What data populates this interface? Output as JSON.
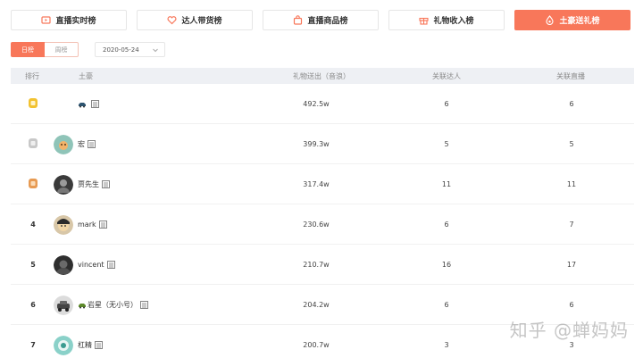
{
  "tabs": [
    {
      "label": "直播实时榜",
      "icon": "live-screen-icon",
      "active": false
    },
    {
      "label": "达人带货榜",
      "icon": "heart-badge-icon",
      "active": false
    },
    {
      "label": "直播商品榜",
      "icon": "shopping-bag-icon",
      "active": false
    },
    {
      "label": "礼物收入榜",
      "icon": "gift-icon",
      "active": false
    },
    {
      "label": "土豪送礼榜",
      "icon": "fire-drop-icon",
      "active": true
    }
  ],
  "filters": {
    "day_label": "日榜",
    "week_label": "周榜",
    "date_value": "2020-05-24"
  },
  "table": {
    "headers": {
      "rank": "排行",
      "user": "土豪",
      "gift": "礼物送出（音浪）",
      "users": "关联达人",
      "live": "关联直播"
    },
    "rows": [
      {
        "rank": "",
        "medal": "gold",
        "name": "",
        "gift": "492.5w",
        "users": "6",
        "live": "6"
      },
      {
        "rank": "",
        "medal": "silver",
        "name": "宏",
        "gift": "399.3w",
        "users": "5",
        "live": "5"
      },
      {
        "rank": "",
        "medal": "bronze",
        "name": "贾先生",
        "gift": "317.4w",
        "users": "11",
        "live": "11"
      },
      {
        "rank": "4",
        "medal": "",
        "name": "mark",
        "gift": "230.6w",
        "users": "6",
        "live": "7"
      },
      {
        "rank": "5",
        "medal": "",
        "name": "vincent",
        "gift": "210.7w",
        "users": "16",
        "live": "17"
      },
      {
        "rank": "6",
        "medal": "",
        "name": "岩星（无小号）",
        "gift": "204.2w",
        "users": "6",
        "live": "6"
      },
      {
        "rank": "7",
        "medal": "",
        "name": "杠精",
        "gift": "200.7w",
        "users": "3",
        "live": "3"
      }
    ]
  },
  "watermark": "知乎 @蝉妈妈",
  "colors": {
    "accent": "#f8775a",
    "header_bg": "#eef0f4",
    "gold": "#f2c230",
    "silver": "#c8c8c8",
    "bronze": "#e79a52"
  }
}
